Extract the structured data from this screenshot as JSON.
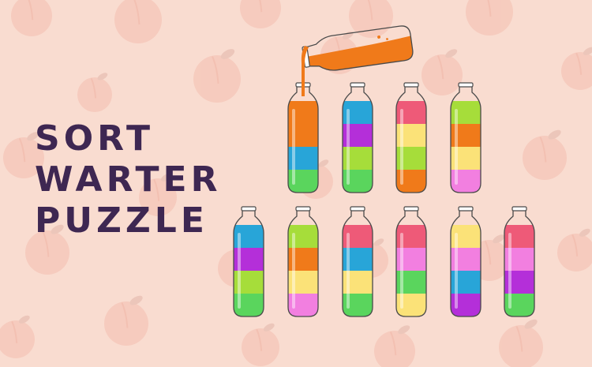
{
  "title": {
    "line1": "SORT",
    "line2": "WARTER",
    "line3": "PUZZLE"
  },
  "colors": {
    "background": "#f9dcd0",
    "peach_decor": "#f6c9bb",
    "leaf_decor": "#eac3b7",
    "title_text": "#3e2752",
    "bottle_outline": "#4a4a4a",
    "orange": "#f07a1a",
    "blue": "#28a5d8",
    "purple": "#b42fd9",
    "green": "#5ad55d",
    "lime": "#a6dd3a",
    "red": "#ee5a78",
    "yellow": "#fbe278",
    "pink": "#f27fe0",
    "orange_pour": "#f07a1a"
  },
  "icons": [
    "peach-icon",
    "leaf-icon",
    "bottle-icon"
  ],
  "pouring_bottle": {
    "color": "orange",
    "fill_fraction": 0.45
  },
  "rows": [
    {
      "bottles": [
        {
          "colors": [
            "orange",
            "orange",
            "blue",
            "green"
          ]
        },
        {
          "colors": [
            "blue",
            "purple",
            "lime",
            "green"
          ]
        },
        {
          "colors": [
            "red",
            "yellow",
            "lime",
            "orange"
          ]
        },
        {
          "colors": [
            "lime",
            "orange",
            "yellow",
            "pink"
          ]
        }
      ]
    },
    {
      "bottles": [
        {
          "colors": [
            "blue",
            "purple",
            "lime",
            "green"
          ]
        },
        {
          "colors": [
            "lime",
            "orange",
            "yellow",
            "pink"
          ]
        },
        {
          "colors": [
            "red",
            "blue",
            "yellow",
            "green"
          ]
        },
        {
          "colors": [
            "red",
            "pink",
            "green",
            "yellow"
          ]
        },
        {
          "colors": [
            "yellow",
            "pink",
            "blue",
            "purple"
          ]
        },
        {
          "colors": [
            "red",
            "pink",
            "purple",
            "green"
          ]
        }
      ]
    }
  ]
}
